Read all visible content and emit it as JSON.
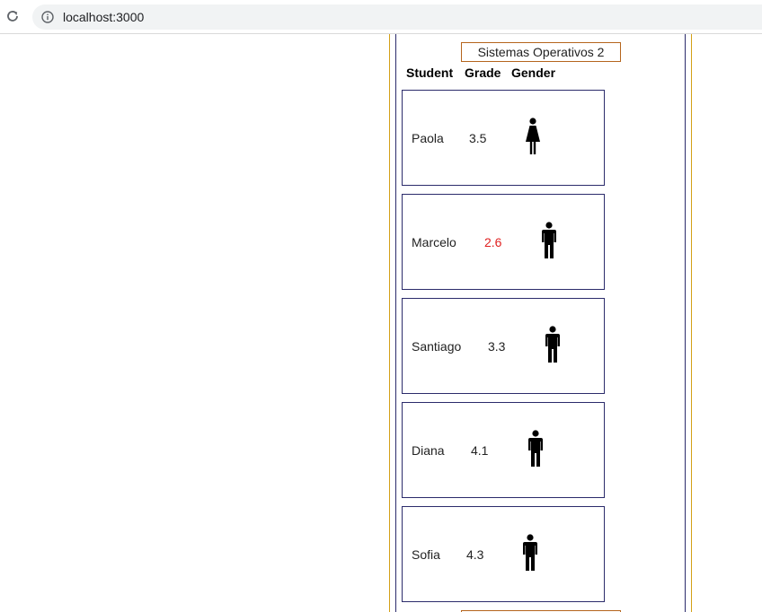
{
  "browser": {
    "url": "localhost:3000"
  },
  "course": {
    "title": "Sistemas Operativos 2"
  },
  "table": {
    "headers": {
      "student": "Student",
      "grade": "Grade",
      "gender": "Gender"
    }
  },
  "students": [
    {
      "name": "Paola",
      "grade": "3.5",
      "gender_icon": "female-icon",
      "grade_color": "#222222"
    },
    {
      "name": "Marcelo",
      "grade": "2.6",
      "gender_icon": "male-icon",
      "grade_color": "#e02020"
    },
    {
      "name": "Santiago",
      "grade": "3.3",
      "gender_icon": "male-icon",
      "grade_color": "#222222"
    },
    {
      "name": "Diana",
      "grade": "4.1",
      "gender_icon": "male-icon",
      "grade_color": "#222222"
    },
    {
      "name": "Sofia",
      "grade": "4.3",
      "gender_icon": "male-icon",
      "grade_color": "#222222"
    }
  ]
}
